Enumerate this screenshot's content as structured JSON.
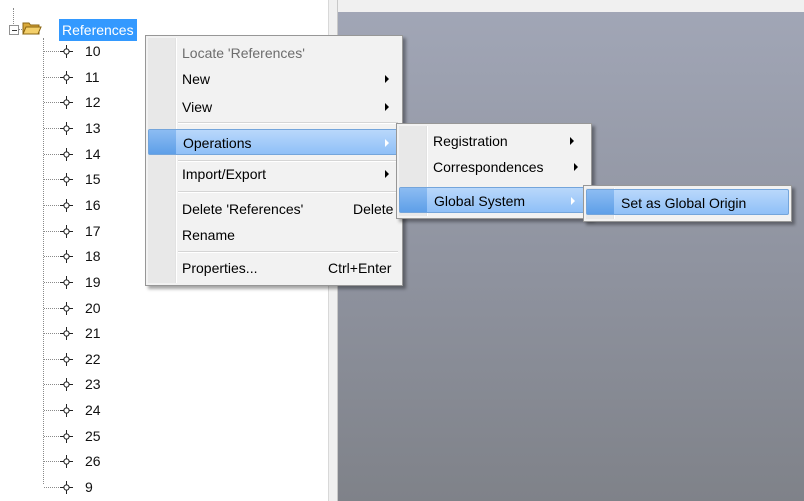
{
  "tree": {
    "root": {
      "label": "References",
      "icon": "folder-open-icon",
      "selected": true
    },
    "items": [
      "10",
      "11",
      "12",
      "13",
      "14",
      "15",
      "16",
      "17",
      "18",
      "19",
      "20",
      "21",
      "22",
      "23",
      "24",
      "25",
      "26",
      "9"
    ],
    "item_icon": "coordinate-node-icon"
  },
  "context_menu": {
    "items": [
      {
        "label": "Locate 'References'",
        "disabled": true
      },
      {
        "label": "New",
        "submenu": true
      },
      {
        "label": "View",
        "submenu": true
      },
      {
        "label": "Operations",
        "submenu": true,
        "highlighted": true
      },
      {
        "label": "Import/Export",
        "submenu": true
      },
      {
        "label": "Delete 'References'",
        "shortcut": "Delete"
      },
      {
        "label": "Rename"
      },
      {
        "label": "Properties...",
        "shortcut": "Ctrl+Enter"
      }
    ]
  },
  "operations_menu": {
    "items": [
      {
        "label": "Registration",
        "submenu": true
      },
      {
        "label": "Correspondences",
        "submenu": true
      },
      {
        "label": "Global System",
        "submenu": true,
        "highlighted": true
      }
    ]
  },
  "global_system_menu": {
    "items": [
      {
        "label": "Set as Global Origin",
        "highlighted": true
      }
    ]
  },
  "colors": {
    "selection": "#3399ff",
    "menu_highlight": "#8fc0f7",
    "menu_background": "#f2f2f2",
    "viewport": "#8e929e"
  }
}
